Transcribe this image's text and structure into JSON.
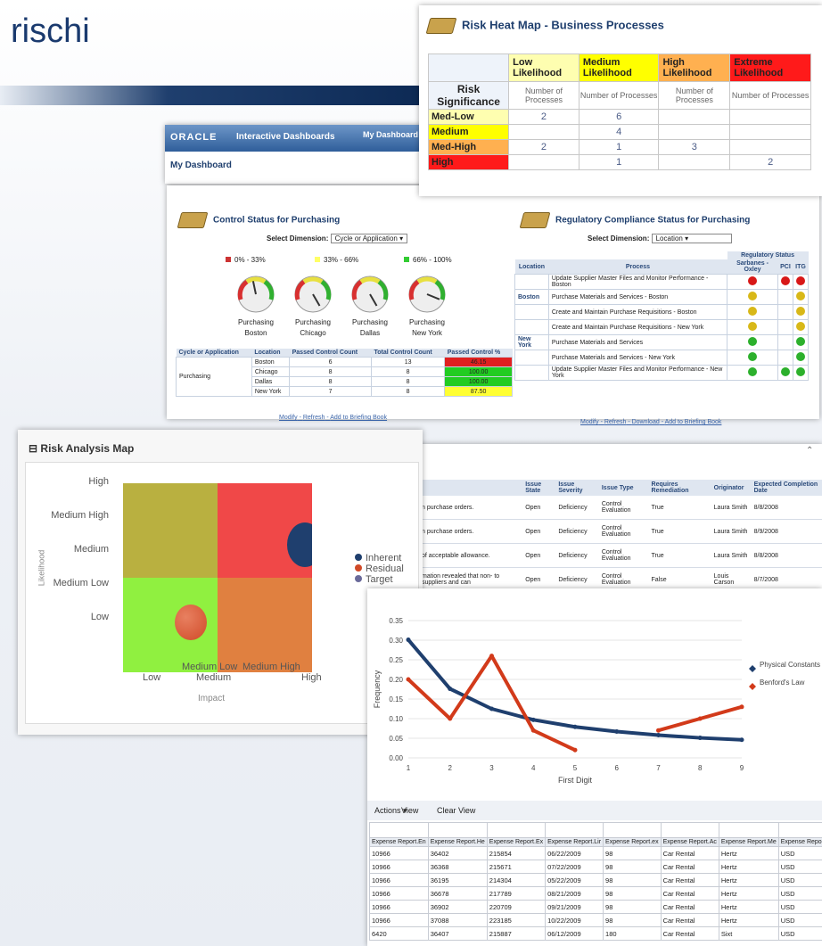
{
  "page_title": "rischi",
  "heatmap": {
    "title": "Risk Heat Map - Business Processes",
    "corner": "Risk Significance",
    "columns": [
      {
        "label": "Low Likelihood",
        "color": "#fefeb0"
      },
      {
        "label": "Medium Likelihood",
        "color": "#ffff00"
      },
      {
        "label": "High Likelihood",
        "color": "#ffb050"
      },
      {
        "label": "Extreme Likelihood",
        "color": "#ff1a1a"
      }
    ],
    "subheader": "Number of Processes",
    "rows": [
      {
        "label": "Med-Low",
        "color": "#fefeb0",
        "values": [
          "2",
          "6",
          "",
          ""
        ]
      },
      {
        "label": "Medium",
        "color": "#ffff00",
        "values": [
          "",
          "4",
          "",
          ""
        ]
      },
      {
        "label": "Med-High",
        "color": "#ffb050",
        "values": [
          "2",
          "1",
          "3",
          ""
        ]
      },
      {
        "label": "High",
        "color": "#ff1a1a",
        "values": [
          "",
          "1",
          "",
          "2"
        ]
      }
    ]
  },
  "oracle": {
    "logo": "ORACLE",
    "app": "Interactive Dashboards",
    "nav": "My Dashboard",
    "page": "My Dashboard"
  },
  "control": {
    "title": "Control Status for Purchasing",
    "select_label": "Select Dimension:",
    "select_value": "Cycle or Application",
    "legend": [
      {
        "label": "0% - 33%",
        "color": "#cc3333"
      },
      {
        "label": "33% - 66%",
        "color": "#ffff66"
      },
      {
        "label": "66% - 100%",
        "color": "#33cc33"
      }
    ],
    "gauges": [
      {
        "line1": "Purchasing",
        "line2": "Boston",
        "level": 0.46
      },
      {
        "line1": "Purchasing",
        "line2": "Chicago",
        "level": 1.0
      },
      {
        "line1": "Purchasing",
        "line2": "Dallas",
        "level": 1.0
      },
      {
        "line1": "Purchasing",
        "line2": "New York",
        "level": 0.875
      }
    ],
    "table": {
      "headers": [
        "Cycle or Application",
        "Location",
        "Passed Control Count",
        "Total Control Count",
        "Passed Control %"
      ],
      "group": "Purchasing",
      "rows": [
        {
          "location": "Boston",
          "passed": "6",
          "total": "13",
          "pct": "46.15",
          "color": "#e02020"
        },
        {
          "location": "Chicago",
          "passed": "8",
          "total": "8",
          "pct": "100.00",
          "color": "#22cc22"
        },
        {
          "location": "Dallas",
          "passed": "8",
          "total": "8",
          "pct": "100.00",
          "color": "#22cc22"
        },
        {
          "location": "New York",
          "passed": "7",
          "total": "8",
          "pct": "87.50",
          "color": "#ffff33"
        }
      ]
    },
    "footer": [
      "Modify",
      "Refresh",
      "Add to Briefing Book"
    ]
  },
  "regulatory": {
    "title": "Regulatory Compliance Status for Purchasing",
    "select_label": "Select Dimension:",
    "select_value": "Location",
    "group_header": "Regulatory Status",
    "headers": [
      "Location",
      "Process",
      "Sarbanes -Oxley",
      "PCI",
      "ITG"
    ],
    "rows": [
      {
        "location": "",
        "process": "Update Supplier Master Files and Monitor Performance - Boston",
        "sox": "red",
        "pci": "red",
        "itg": "red"
      },
      {
        "location": "Boston",
        "process": "Purchase Materials and Services - Boston",
        "sox": "yellow",
        "pci": "",
        "itg": "yellow"
      },
      {
        "location": "",
        "process": "Create and Maintain Purchase Requisitions - Boston",
        "sox": "yellow",
        "pci": "",
        "itg": "yellow"
      },
      {
        "location": "",
        "process": "Create and Maintain Purchase Requisitions - New York",
        "sox": "yellow",
        "pci": "",
        "itg": "yellow"
      },
      {
        "location": "New York",
        "process": "Purchase Materials and Services",
        "sox": "green",
        "pci": "",
        "itg": "green"
      },
      {
        "location": "",
        "process": "Purchase Materials and Services - New York",
        "sox": "green",
        "pci": "",
        "itg": "green"
      },
      {
        "location": "",
        "process": "Update Supplier Master Files and Monitor Performance - New York",
        "sox": "green",
        "pci": "green",
        "itg": "green"
      }
    ],
    "dot_colors": {
      "red": "#d81818",
      "yellow": "#d8b818",
      "green": "#2cb02c"
    },
    "footer": [
      "Modify",
      "Refresh",
      "Download",
      "Add to Briefing Book"
    ]
  },
  "issues": {
    "headers": [
      "",
      "Issue State",
      "Issue Severity",
      "Issue Type",
      "Requires Remediation",
      "Originator",
      "Expected Completion Date"
    ],
    "rows": [
      [
        "n purchase orders.",
        "Open",
        "Deficiency",
        "Control Evaluation",
        "True",
        "Laura Smith",
        "8/8/2008"
      ],
      [
        "n purchase orders.",
        "Open",
        "Deficiency",
        "Control Evaluation",
        "True",
        "Laura Smith",
        "8/9/2008"
      ],
      [
        "of acceptable allowance.",
        "Open",
        "Deficiency",
        "Control Evaluation",
        "True",
        "Laura Smith",
        "8/8/2008"
      ],
      [
        "mation revealed that non- to suppliers and can",
        "Open",
        "Deficiency",
        "Control Evaluation",
        "False",
        "Louis Carson",
        "8/7/2008"
      ]
    ]
  },
  "risk_map": {
    "title": "Risk Analysis Map",
    "y_labels": [
      "High",
      "Medium High",
      "Medium",
      "Medium Low",
      "Low"
    ],
    "x_labels_top": [
      "Medium Low",
      "Medium High"
    ],
    "x_labels_bottom": [
      "Low",
      "Medium",
      "High"
    ],
    "y_axis": "Likelihood",
    "x_axis": "Impact",
    "legend": [
      {
        "label": "Inherent",
        "color": "#1f3f6e"
      },
      {
        "label": "Residual",
        "color": "#d04a28"
      },
      {
        "label": "Target",
        "color": "#6a6a9a"
      }
    ],
    "quadrant_colors": [
      "#b9b040",
      "#f04848",
      "#90f040",
      "#e08040"
    ]
  },
  "chart_data": {
    "type": "line",
    "xlabel": "First Digit",
    "ylabel": "Frequency",
    "x": [
      1,
      2,
      3,
      4,
      5,
      6,
      7,
      8,
      9
    ],
    "ylim": [
      0,
      0.35
    ],
    "y_ticks": [
      "0.00",
      "0.05",
      "0.10",
      "0.15",
      "0.20",
      "0.25",
      "0.30",
      "0.35"
    ],
    "series": [
      {
        "name": "Physical Constants",
        "color": "#1f3f6e",
        "values": [
          0.301,
          0.176,
          0.125,
          0.097,
          0.079,
          0.067,
          0.058,
          0.051,
          0.046
        ]
      },
      {
        "name": "Benford's Law",
        "color": "#d23a1a",
        "values": [
          0.2,
          0.1,
          0.26,
          0.07,
          0.02,
          null,
          0.07,
          0.1,
          0.13
        ]
      }
    ]
  },
  "data_table": {
    "toolbar": [
      "Actions ▾",
      "View",
      "Clear View"
    ],
    "headers": [
      "Expense Report.En",
      "Expense Report.He",
      "Expense Report.Ex",
      "Expense Report.Lir",
      "Expense Report.ex",
      "Expense Report.Ac",
      "Expense Report.Me",
      "Expense Report.Cu"
    ],
    "rows": [
      [
        "10966",
        "36402",
        "215854",
        "06/22/2009",
        "98",
        "Car Rental",
        "Hertz",
        "USD"
      ],
      [
        "10966",
        "36368",
        "215671",
        "07/22/2009",
        "98",
        "Car Rental",
        "Hertz",
        "USD"
      ],
      [
        "10966",
        "36195",
        "214304",
        "05/22/2009",
        "98",
        "Car Rental",
        "Hertz",
        "USD"
      ],
      [
        "10966",
        "36678",
        "217789",
        "08/21/2009",
        "98",
        "Car Rental",
        "Hertz",
        "USD"
      ],
      [
        "10966",
        "36902",
        "220709",
        "09/21/2009",
        "98",
        "Car Rental",
        "Hertz",
        "USD"
      ],
      [
        "10966",
        "37088",
        "223185",
        "10/22/2009",
        "98",
        "Car Rental",
        "Hertz",
        "USD"
      ],
      [
        "6420",
        "36407",
        "215887",
        "06/12/2009",
        "180",
        "Car Rental",
        "Sixt",
        "USD"
      ]
    ]
  }
}
